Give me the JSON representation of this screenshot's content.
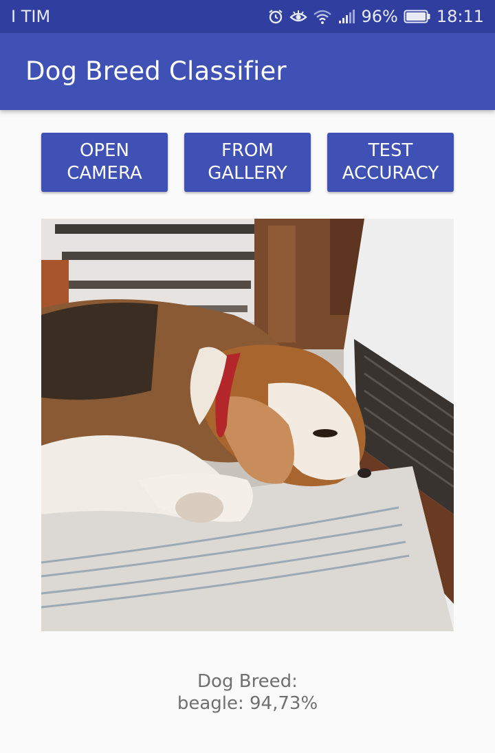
{
  "status_bar": {
    "carrier": "I TIM",
    "battery": "96%",
    "time": "18:11",
    "icons": [
      "alarm-icon",
      "eye-icon",
      "wifi-icon",
      "signal-icon",
      "battery-icon"
    ]
  },
  "app_bar": {
    "title": "Dog Breed Classifier",
    "color": "#3f51b5"
  },
  "buttons": {
    "open_camera": [
      "OPEN",
      "CAMERA"
    ],
    "from_gallery": [
      "FROM",
      "GALLERY"
    ],
    "test_accuracy": [
      "TEST",
      "ACCURACY"
    ]
  },
  "photo": {
    "subject": "beagle sleeping on floor"
  },
  "result": {
    "label": "Dog Breed:",
    "value": "beagle: 94,73%"
  },
  "colors": {
    "status_bar": "#303f9f",
    "primary": "#3f51b5",
    "background": "#fafafa",
    "result_text": "#6f6f6f"
  }
}
